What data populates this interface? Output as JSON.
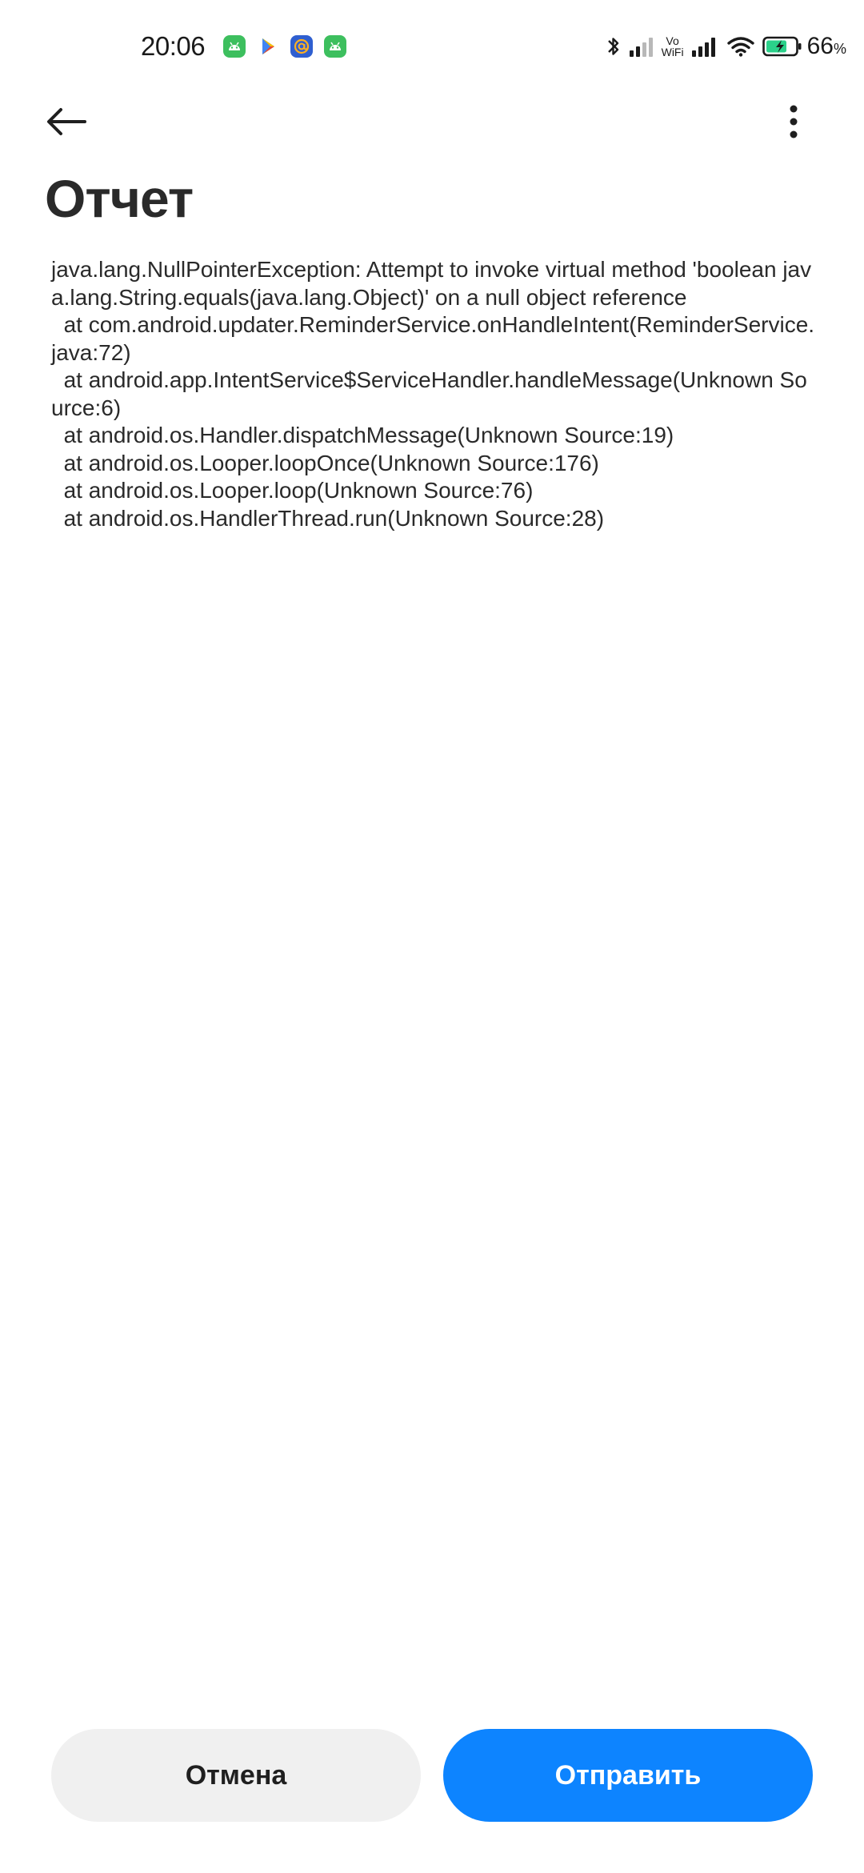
{
  "status_bar": {
    "time": "20:06",
    "vowifi_top": "Vo",
    "vowifi_bottom": "WiFi",
    "battery_value": "66",
    "battery_unit": "%",
    "notification_icons": [
      "android-icon",
      "play-store-icon",
      "mail-at-icon",
      "android-icon"
    ]
  },
  "app_bar": {
    "back_icon": "arrow-left-icon",
    "menu_icon": "more-vertical-icon"
  },
  "page": {
    "title": "Отчет",
    "report": "java.lang.NullPointerException: Attempt to invoke virtual method 'boolean java.lang.String.equals(java.lang.Object)' on a null object reference\n  at com.android.updater.ReminderService.onHandleIntent(ReminderService.java:72)\n  at android.app.IntentService$ServiceHandler.handleMessage(Unknown Source:6)\n  at android.os.Handler.dispatchMessage(Unknown Source:19)\n  at android.os.Looper.loopOnce(Unknown Source:176)\n  at android.os.Looper.loop(Unknown Source:76)\n  at android.os.HandlerThread.run(Unknown Source:28)"
  },
  "actions": {
    "cancel_label": "Отмена",
    "send_label": "Отправить"
  },
  "colors": {
    "accent": "#0d84ff",
    "secondary_button": "#f0f0f0",
    "notif_green": "#3dbf5e",
    "notif_blue": "#2f5fd0"
  }
}
